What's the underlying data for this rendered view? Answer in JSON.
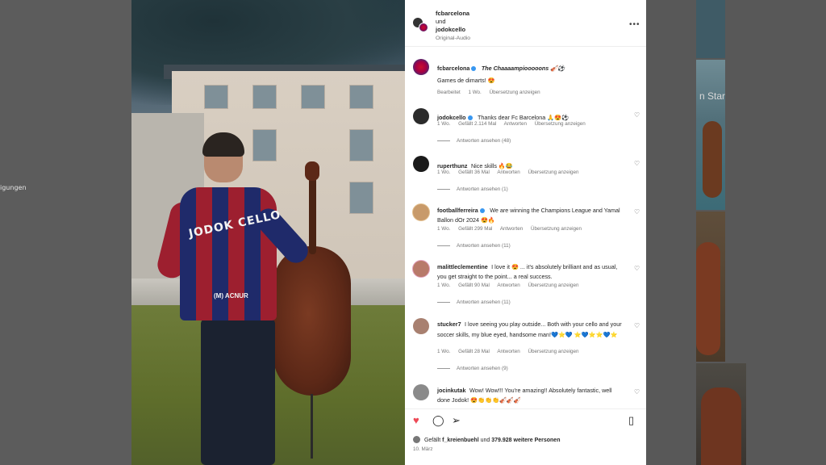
{
  "left_fragments": [
    "",
    "igungen"
  ],
  "post_header": {
    "author1": "fcbarcelona",
    "joiner": "und",
    "author2": "jodokcello",
    "audio": "Original-Audio",
    "more_icon": "more-icon"
  },
  "caption": {
    "username": "fcbarcelona",
    "title": "The Chaaaampiooooons 🎻⚽",
    "line2": "Games de dimarts! 😍",
    "meta_edited": "Bearbeitet",
    "meta_time": "1 Wo.",
    "meta_translate": "Übersetzung anzeigen"
  },
  "comments": [
    {
      "username": "jodokcello",
      "verified": true,
      "text": "Thanks dear Fc Barcelona 🙏😍⚽",
      "time": "1 Wo.",
      "likes": "Gefällt 2.114 Mal",
      "reply": "Antworten",
      "translate": "Übersetzung anzeigen",
      "replies": "Antworten ansehen (48)",
      "avatar_color": "#2b2b2b"
    },
    {
      "username": "ruperthunz",
      "verified": false,
      "text": "Nice skills 🔥😂",
      "time": "1 Wo.",
      "likes": "Gefällt 36 Mal",
      "reply": "Antworten",
      "translate": "Übersetzung anzeigen",
      "replies": "Antworten ansehen (1)",
      "avatar_color": "#1a1a1a"
    },
    {
      "username": "footballferreira",
      "verified": true,
      "text": "We are winning the Champions League and Yamal Ballon dOr 2024 😍🔥",
      "time": "1 Wo.",
      "likes": "Gefällt 299 Mal",
      "reply": "Antworten",
      "translate": "Übersetzung anzeigen",
      "replies": "Antworten ansehen (11)",
      "avatar_color": "#c89a6a"
    },
    {
      "username": "malittleclementine",
      "verified": false,
      "text": "I love it 😍 ... it's absolutely brilliant and as usual, you get straight to the point... a real success.",
      "time": "1 Wo.",
      "likes": "Gefällt 90 Mal",
      "reply": "Antworten",
      "translate": "Übersetzung anzeigen",
      "replies": "Antworten ansehen (11)",
      "avatar_color": "#b87a6a"
    },
    {
      "username": "stucker7",
      "verified": false,
      "text": "I love seeing you play outside... Both with your cello and your soccer skills, my blue eyed, handsome man!💙⭐💙 ⭐💙⭐⭐💙⭐",
      "time": "1 Wo.",
      "likes": "Gefällt 28 Mal",
      "reply": "Antworten",
      "translate": "Übersetzung anzeigen",
      "replies": "Antworten ansehen (9)",
      "avatar_color": "#a88070"
    },
    {
      "username": "jocinkutak",
      "verified": false,
      "text": "Wow! Wow!!! You're amazing!! Absolutely fantastic, well done Jodok! 😍👏👏👏🎻🎻🎻",
      "time": "",
      "likes": "",
      "reply": "",
      "translate": "",
      "replies": "",
      "avatar_color": "#8a8a8a"
    }
  ],
  "footer": {
    "liked_by_prefix": "Gefällt",
    "liked_by_user": "f_kreienbuehl",
    "liked_by_mid": "und",
    "liked_by_count": "379.928 weitere Personen",
    "date": "10. März",
    "like_color": "#ed4956"
  },
  "photo": {
    "jersey_name": "JODOK CELLO",
    "sponsor": "(M) ACNUR"
  }
}
